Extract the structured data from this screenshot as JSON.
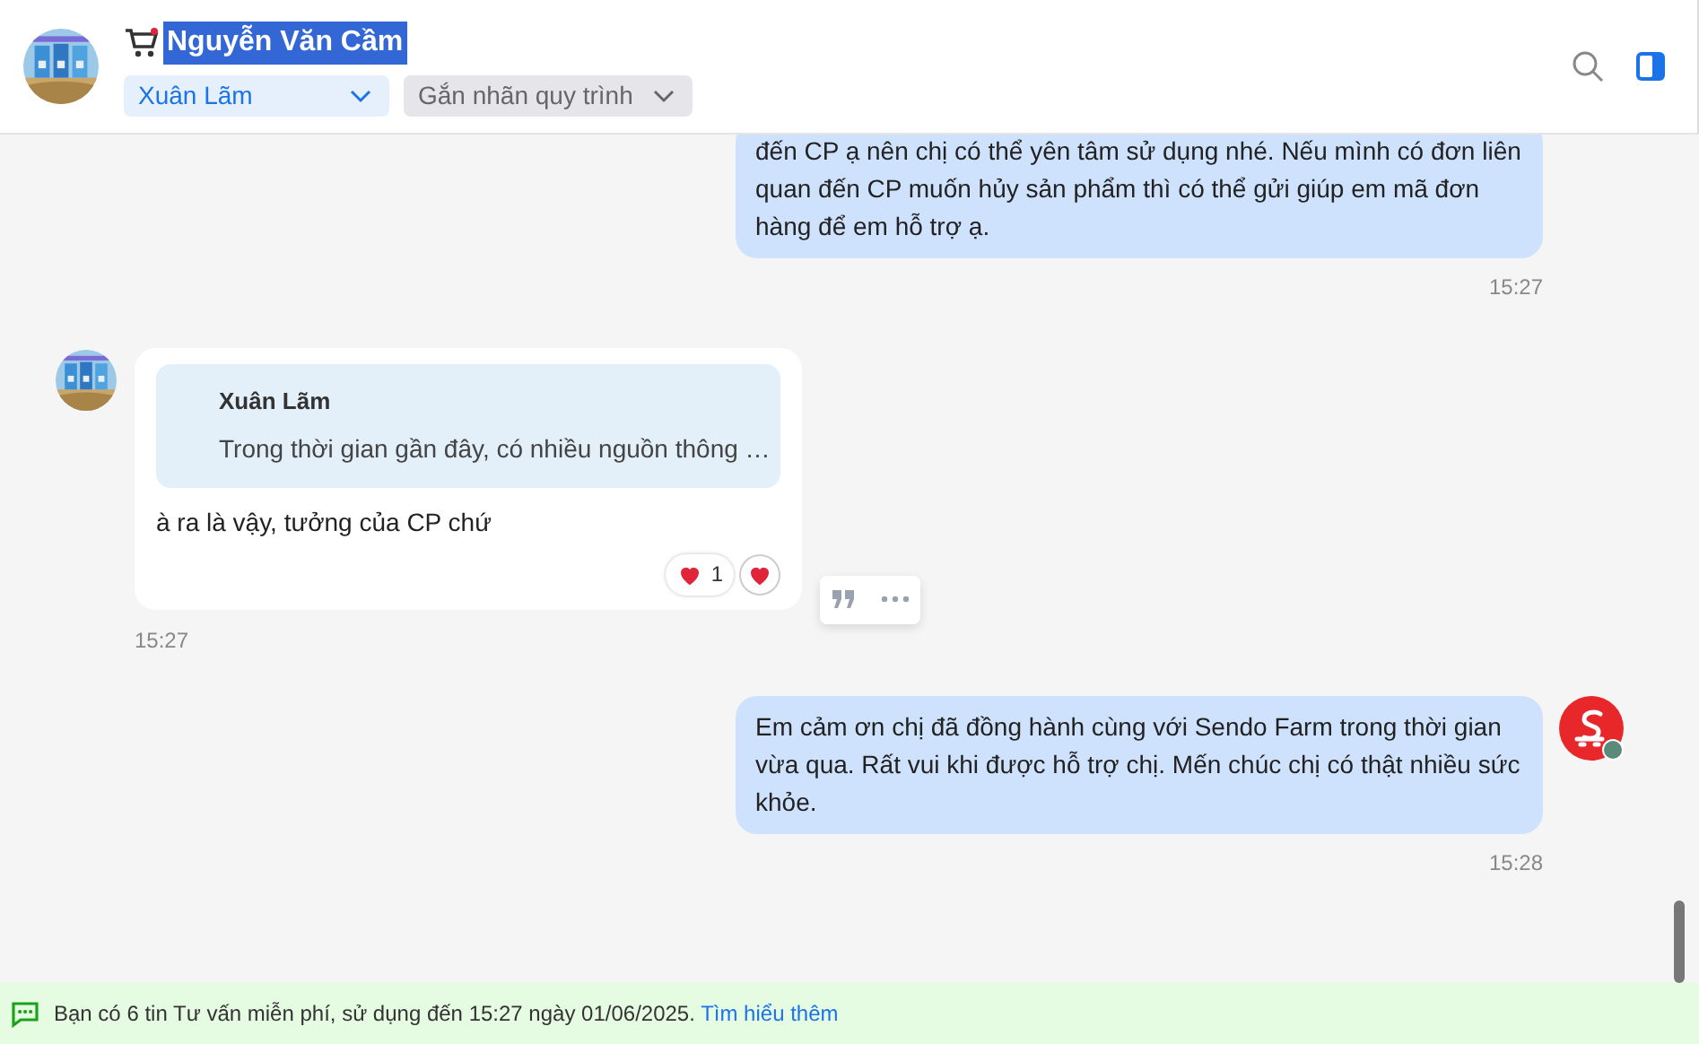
{
  "header": {
    "title": "Nguyễn Văn Cầm",
    "title_highlighted": true,
    "assignee": "Xuân Lãm",
    "tag_placeholder": "Gắn nhãn quy trình"
  },
  "messages": [
    {
      "kind": "outgoing",
      "text": "đến CP ạ nên chị có thể yên tâm sử dụng nhé. Nếu mình có đơn liên quan đến CP muốn hủy sản phẩm thì có thể gửi giúp em mã đơn hàng để em hỗ trợ ạ.",
      "time": "15:27"
    },
    {
      "kind": "incoming",
      "quote": {
        "author": "Xuân Lãm",
        "text": "Trong thời gian gần đây, có nhiều nguồn thông …"
      },
      "text": "à ra là vậy, tưởng của CP chứ",
      "reactions": [
        {
          "count": "1"
        }
      ],
      "time": "15:27"
    },
    {
      "kind": "outgoing",
      "text": "Em cảm ơn chị đã đồng hành cùng với Sendo Farm trong thời gian vừa qua. Rất vui khi được hỗ trợ chị. Mến chúc chị có thật nhiều sức khỏe.",
      "time": "15:28",
      "avatar": true
    }
  ],
  "footer": {
    "text": "Bạn có 6 tin Tư vấn miễn phí, sử dụng đến 15:27 ngày 01/06/2025.",
    "link": "Tìm hiểu thêm"
  }
}
